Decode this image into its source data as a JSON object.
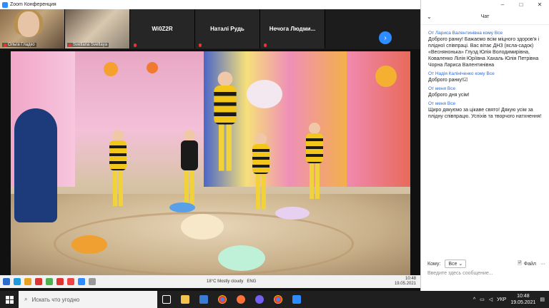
{
  "window": {
    "title": "Zoom Конференция",
    "minimize": "–",
    "maximize": "□",
    "close": "✕"
  },
  "participants": [
    {
      "name": "Ольга Гладко",
      "kind": "video1"
    },
    {
      "name": "Svetlana Svetlaya",
      "kind": "video2"
    },
    {
      "name": "Wi0Z2R",
      "kind": "name"
    },
    {
      "name": "Наталі Рудь",
      "kind": "name"
    },
    {
      "name": "Нечога  Людми...",
      "kind": "name"
    }
  ],
  "nav": {
    "next_icon": "›"
  },
  "chat": {
    "title": "Чат",
    "collapse_icon": "⌄",
    "messages": [
      {
        "from_prefix": "От",
        "from": "Лариса Валентинівна",
        "to_prefix": "кому",
        "to": "Все",
        "text": "Доброго ранку! Бажаємо всім міцного здоров'я і плідної співпраці. Вас вітає ДНЗ (ясла-садок) «Веснянонька» Глузд Юлія Володимирівна, Коваленко Лілія Юріївна Хахаль Юлія Петрівна Чорна Лариса Валентинівна"
      },
      {
        "from_prefix": "От",
        "from": "Надія Калініченко",
        "to_prefix": "кому",
        "to": "Все",
        "text": "Доброго ранку!☑"
      },
      {
        "from_prefix": "От",
        "from": "меня",
        "to_prefix": "",
        "to": "Все",
        "text": "Доброго дня усім!"
      },
      {
        "from_prefix": "От",
        "from": "меня",
        "to_prefix": "",
        "to": "Все",
        "text": "Щиро дякуємо за цікаве свято! Дякую усім за плідну співпрацю. Успіхів та творчого натхнення!"
      }
    ],
    "to_label": "Кому:",
    "to_value": "Все",
    "file_label": "Файл",
    "more_icon": "···",
    "input_placeholder": "Введите здесь сообщение..."
  },
  "inner_taskbar": {
    "weather": "18°C  Mostly cloudy",
    "lang": "ENG",
    "time": "10:48",
    "date": "19.05.2021"
  },
  "taskbar": {
    "search_placeholder": "Искать что угодно",
    "lang": "УКР",
    "time": "10:48",
    "date": "19.05.2021"
  },
  "colors": {
    "accent": "#2d8cff",
    "chat_meta": "#2d6bd6"
  }
}
